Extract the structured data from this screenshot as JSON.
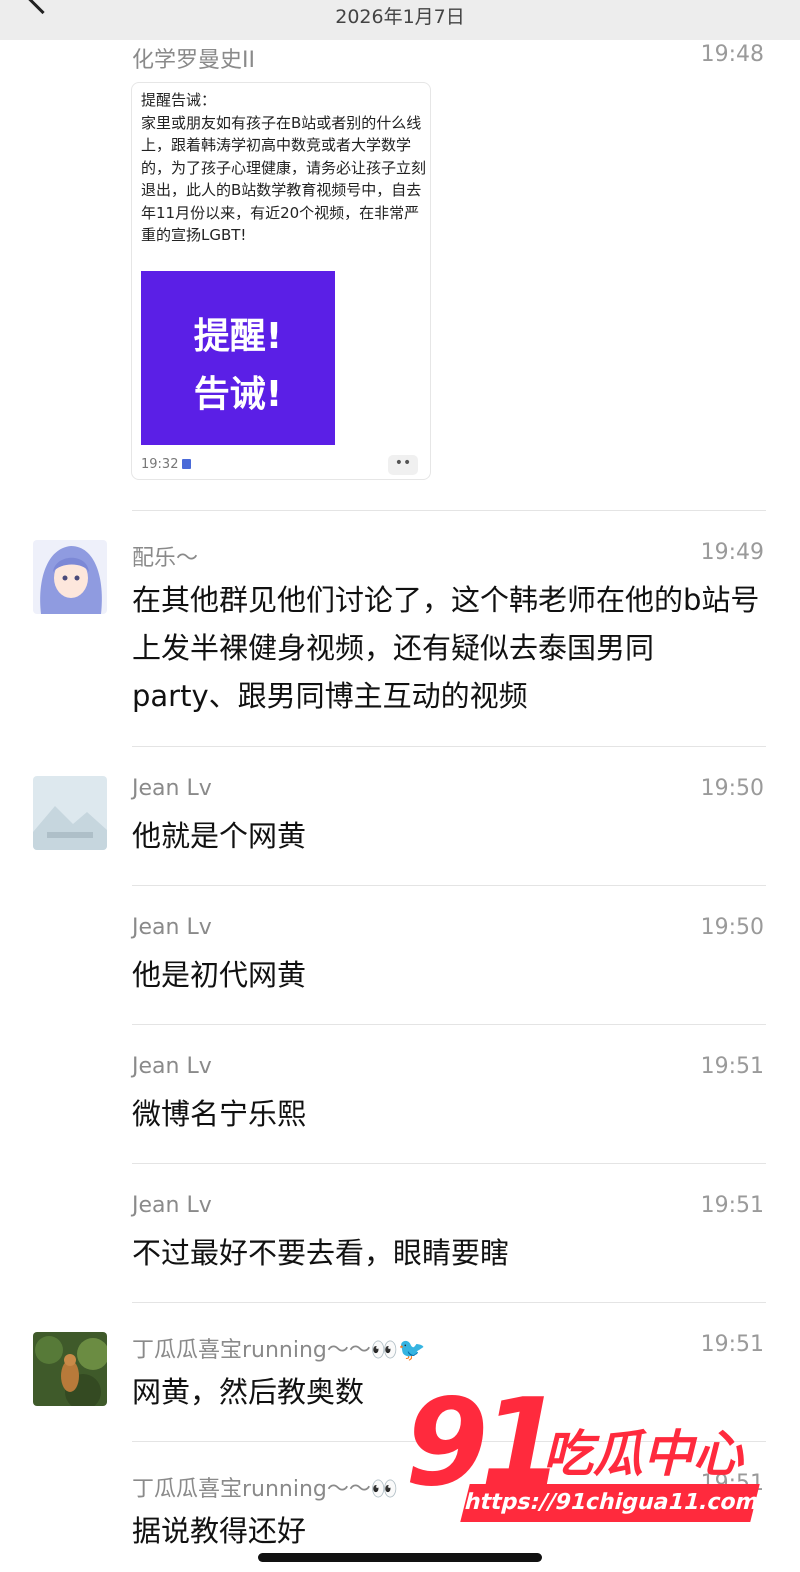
{
  "header": {
    "date": "2026年1月7日"
  },
  "watermark": {
    "big": "91",
    "cn": "吃瓜中心",
    "url": "https://91chigua11.com"
  },
  "messages": [
    {
      "sender": "化学罗曼史II",
      "time": "19:48",
      "shared_card": {
        "text": "提醒告诫：\n家里或朋友如有孩子在B站或者别的什么线上，跟着韩涛学初高中数竞或者大学数学的，为了孩子心理健康，请务必让孩子立刻退出，此人的B站数学教育视频号中，自去年11月份以来，有近20个视频，在非常严重的宣扬LGBT!",
        "image_lines": [
          "提醒!",
          "告诫!"
        ],
        "time": "19:32",
        "more": "••"
      }
    },
    {
      "sender": "配乐～",
      "time": "19:49",
      "text": "在其他群见他们讨论了，这个韩老师在他的b站号上发半裸健身视频，还有疑似去泰国男同 party、跟男同博主互动的视频"
    },
    {
      "sender": "Jean Lv",
      "time": "19:50",
      "text": "他就是个网黄"
    },
    {
      "sender": "Jean Lv",
      "time": "19:50",
      "text": "他是初代网黄"
    },
    {
      "sender": "Jean Lv",
      "time": "19:51",
      "text": "微博名宁乐熙"
    },
    {
      "sender": "Jean Lv",
      "time": "19:51",
      "text": "不过最好不要去看，眼睛要瞎"
    },
    {
      "sender": "丁瓜瓜喜宝running～～👀🐦",
      "time": "19:51",
      "text": "网黄，然后教奥数"
    },
    {
      "sender": "丁瓜瓜喜宝running～～👀",
      "time": "19:51",
      "text": "据说教得还好"
    }
  ]
}
